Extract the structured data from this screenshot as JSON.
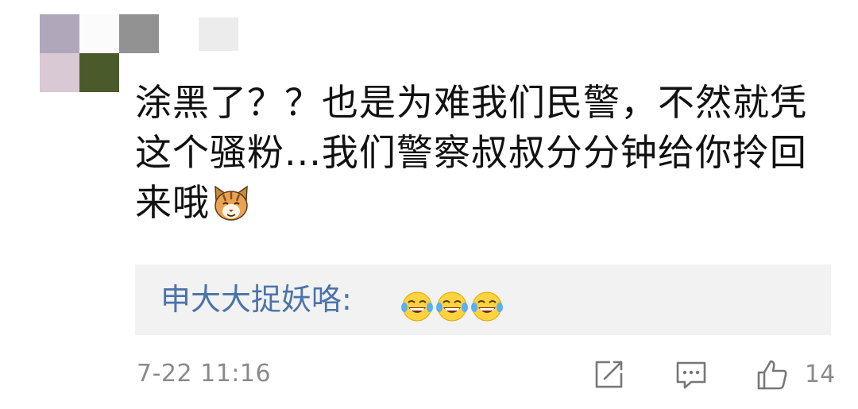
{
  "comment": {
    "text": "涂黑了？？也是为难我们民警，不然就凭这个骚粉...我们警察叔叔分分钟给你拎回来哦",
    "trailing_emoji": "cat-face-icon",
    "timestamp": "7-22 11:16",
    "like_count": "14"
  },
  "reply": {
    "author": "申大大捉妖咯:",
    "emojis": [
      "laughing-tears-icon",
      "laughing-tears-icon",
      "laughing-tears-icon"
    ]
  },
  "actions": {
    "share_icon": "share-edit-icon",
    "comment_icon": "comment-bubble-icon",
    "like_icon": "thumbs-up-icon"
  },
  "colors": {
    "link": "#4b73aa",
    "meta": "#8a8a8a",
    "reply_bg": "#f2f2f2"
  }
}
